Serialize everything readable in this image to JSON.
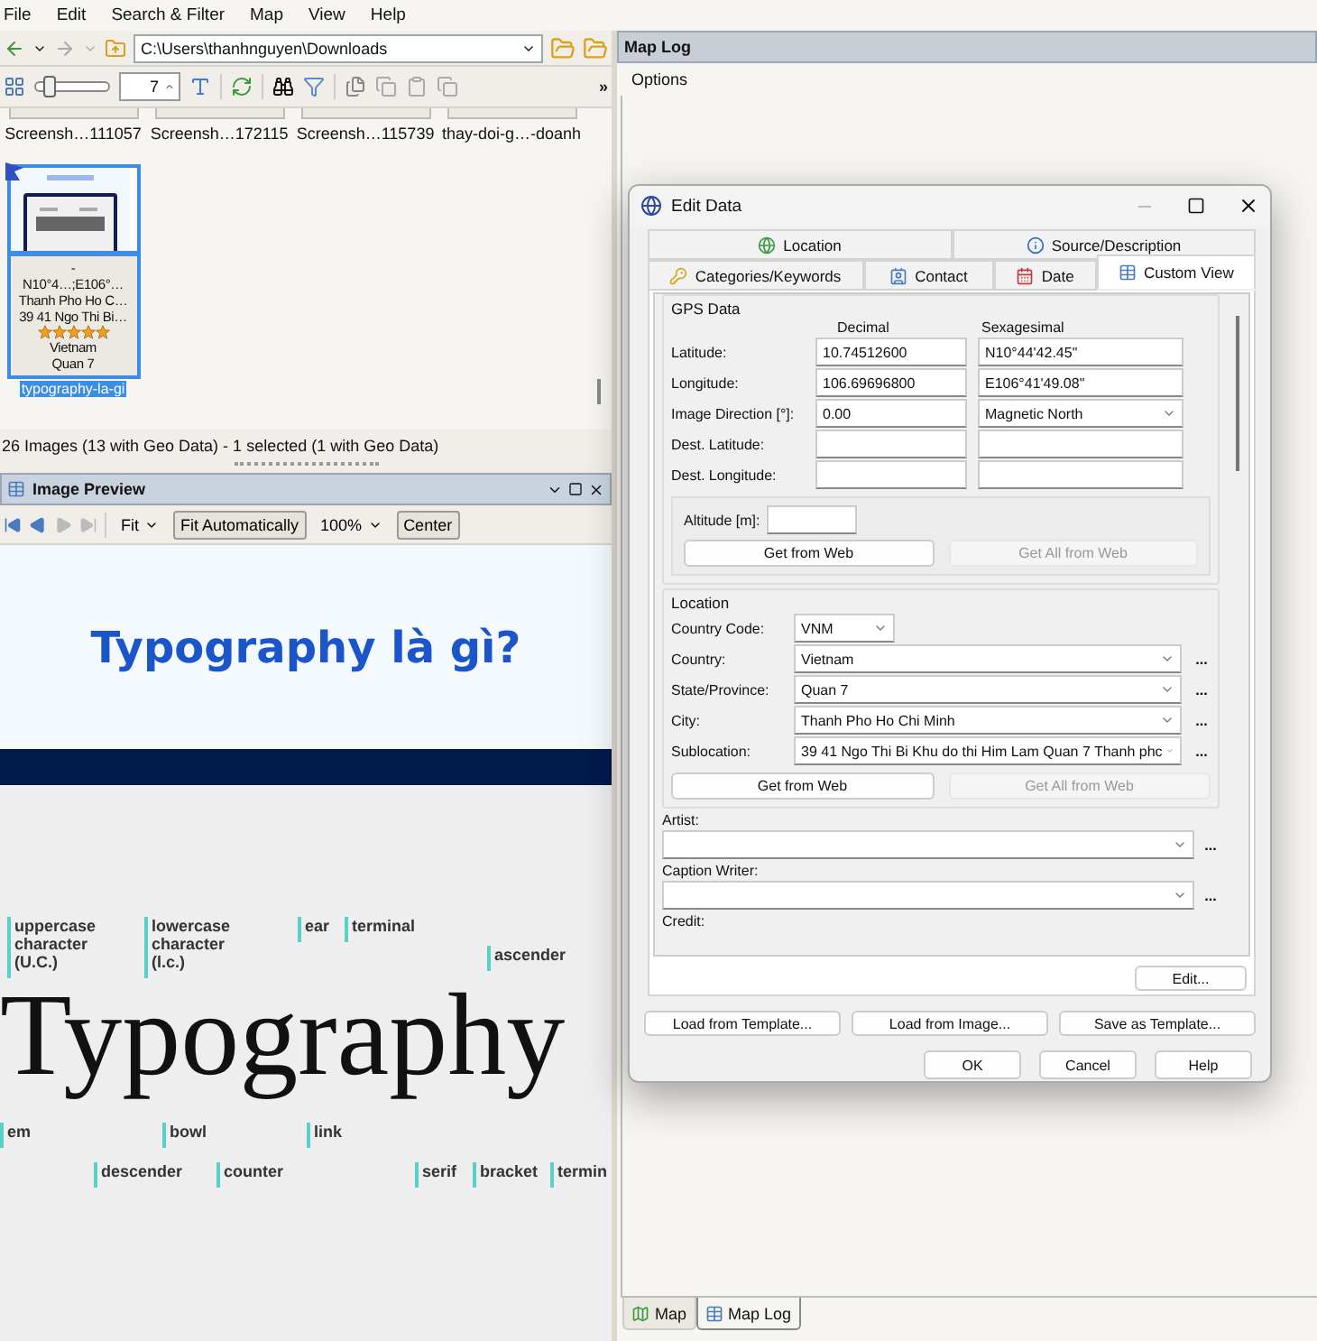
{
  "menu": [
    "File",
    "Edit",
    "Search & Filter",
    "Map",
    "View",
    "Help"
  ],
  "address": {
    "path": "C:\\Users\\thanhnguyen\\Downloads"
  },
  "toolbar": {
    "zoom_slider": {
      "level": 0.1
    },
    "size": "7",
    "overflow": "»"
  },
  "thumbnail_row": [
    {
      "caption": "Screensh…111057"
    },
    {
      "caption": "Screensh…172115"
    },
    {
      "caption": "Screensh…115739"
    },
    {
      "caption": "thay-doi-g…-doanh"
    }
  ],
  "current_thumbnail": {
    "selected": true,
    "lines": [
      "-",
      "N10°4…;E106°…",
      "Thanh Pho Ho C…",
      "39 41 Ngo Thi Bi…"
    ],
    "stars": 5,
    "after_lines": [
      "Vietnam",
      "Quan 7"
    ],
    "filename": "typography-la-gi"
  },
  "status": "26 Images (13 with Geo Data) - 1 selected (1 with Geo Data)",
  "preview": {
    "title": "Image Preview",
    "fit": "Fit",
    "fit_auto": {
      "label": "Fit Automatically",
      "pressed": true
    },
    "zoom": "100%",
    "center": {
      "label": "Center",
      "pressed": true
    }
  },
  "preview_image": {
    "title": "Typography là gì?",
    "word": "Typography",
    "labels": [
      "uppercase\ncharacter\n(U.C.)",
      "lowercase\ncharacter\n(l.c.)",
      "ear",
      "terminal",
      "ascender",
      "em",
      "bowl",
      "link",
      "descender",
      "counter",
      "serif",
      "bracket",
      "termin"
    ]
  },
  "map_pane": {
    "title": "Map Log",
    "menu": [
      "Options"
    ],
    "tabs": [
      {
        "label": "Map",
        "selected": false
      },
      {
        "label": "Map Log",
        "selected": true
      }
    ]
  },
  "dialog": {
    "title": "Edit Data",
    "tab_rows": [
      {
        "tabs": [
          {
            "label": "Location",
            "selected": false
          },
          {
            "label": "Source/Description",
            "selected": false
          }
        ]
      },
      {
        "tabs": [
          {
            "label": "Categories/Keywords",
            "selected": false
          },
          {
            "label": "Contact",
            "selected": false
          },
          {
            "label": "Date",
            "selected": false
          },
          {
            "label": "Custom View",
            "selected": true
          }
        ]
      }
    ],
    "gps": {
      "title": "GPS Data",
      "headers": [
        "Decimal",
        "Sexagesimal"
      ],
      "rows": [
        {
          "label": "Latitude:",
          "decimal": "10.74512600",
          "sexagesimal": "N10°44'42.45\"",
          "kind": "text"
        },
        {
          "label": "Longitude:",
          "decimal": "106.69696800",
          "sexagesimal": "E106°41'49.08\"",
          "kind": "text"
        },
        {
          "label": "Image Direction [°]:",
          "decimal": "0.00",
          "sexagesimal": "Magnetic North",
          "kind": "select"
        },
        {
          "label": "Dest. Latitude:",
          "kind": "text"
        },
        {
          "label": "Dest. Longitude:",
          "kind": "text"
        }
      ],
      "altitude": "Altitude [m]:",
      "buttons": [
        {
          "label": "Get from Web",
          "disabled": false
        },
        {
          "label": "Get All from Web",
          "disabled": true
        }
      ]
    },
    "location": {
      "title": "Location",
      "fields": [
        {
          "label": "Country Code:",
          "value": "VNM",
          "kind": "short"
        },
        {
          "label": "Country:",
          "value": "Vietnam",
          "kind": "wide",
          "more": "..."
        },
        {
          "label": "State/Province:",
          "value": "Quan 7",
          "kind": "wide",
          "more": "..."
        },
        {
          "label": "City:",
          "value": "Thanh Pho Ho Chi Minh",
          "kind": "wide",
          "more": "..."
        },
        {
          "label": "Sublocation:",
          "value": "39 41 Ngo Thi Bi Khu do thi Him Lam Quan 7 Thanh phc",
          "kind": "wide",
          "more": "..."
        }
      ],
      "buttons": [
        {
          "label": "Get from Web",
          "disabled": false
        },
        {
          "label": "Get All from Web",
          "disabled": true
        }
      ]
    },
    "extra_fields": [
      {
        "label": "Artist:",
        "kind": "combo",
        "more": "..."
      },
      {
        "label": "Caption Writer:",
        "kind": "combo",
        "more": "..."
      },
      {
        "label": "Credit:",
        "kind": "label"
      }
    ],
    "edit": "Edit...",
    "template_buttons": [
      "Load from Template...",
      "Load from Image...",
      "Save as Template..."
    ],
    "buttons": [
      "OK",
      "Cancel",
      "Help"
    ]
  }
}
